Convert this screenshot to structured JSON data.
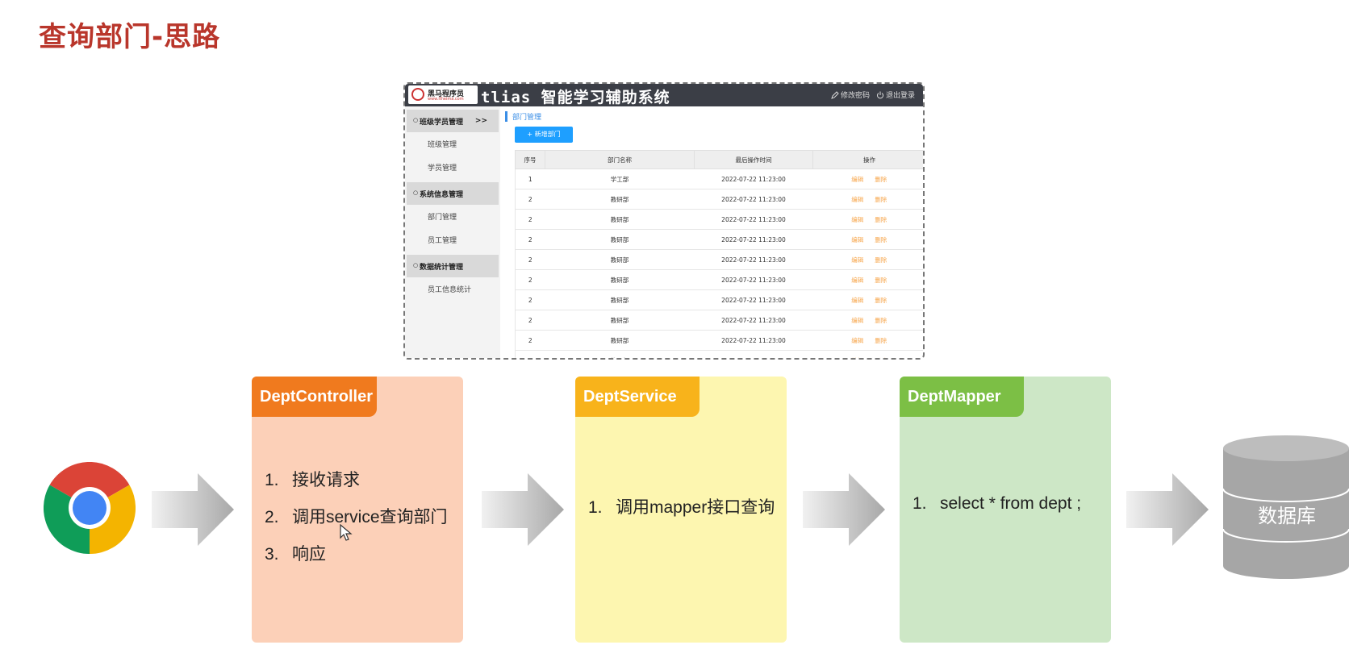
{
  "slide_title": "查询部门-思路",
  "screenshot": {
    "logo_text": "黑马程序员",
    "logo_sub": "www.itheima.com",
    "app_title": "tlias 智能学习辅助系统",
    "header_actions": [
      "修改密码",
      "退出登录"
    ],
    "sidebar": [
      {
        "type": "group",
        "label": "班级学员管理",
        "arrow": ">>"
      },
      {
        "type": "item",
        "label": "班级管理"
      },
      {
        "type": "item",
        "label": "学员管理"
      },
      {
        "type": "group",
        "label": "系统信息管理"
      },
      {
        "type": "item",
        "label": "部门管理"
      },
      {
        "type": "item",
        "label": "员工管理"
      },
      {
        "type": "group",
        "label": "数据统计管理"
      },
      {
        "type": "item",
        "label": "员工信息统计"
      }
    ],
    "breadcrumb": "部门管理",
    "add_button": "+ 新增部门",
    "table": {
      "columns": [
        "序号",
        "部门名称",
        "最后操作时间",
        "操作"
      ],
      "rows": [
        [
          "1",
          "学工部",
          "2022-07-22 11:23:00"
        ],
        [
          "2",
          "教研部",
          "2022-07-22 11:23:00"
        ],
        [
          "2",
          "教研部",
          "2022-07-22 11:23:00"
        ],
        [
          "2",
          "教研部",
          "2022-07-22 11:23:00"
        ],
        [
          "2",
          "教研部",
          "2022-07-22 11:23:00"
        ],
        [
          "2",
          "教研部",
          "2022-07-22 11:23:00"
        ],
        [
          "2",
          "教研部",
          "2022-07-22 11:23:00"
        ],
        [
          "2",
          "教研部",
          "2022-07-22 11:23:00"
        ],
        [
          "2",
          "教研部",
          "2022-07-22 11:23:00"
        ],
        [
          "2",
          "教研部",
          "2022-07-22 11:23:00"
        ]
      ],
      "actions": [
        "编辑",
        "删除"
      ]
    }
  },
  "flow": {
    "controller": {
      "title": "DeptController",
      "steps": [
        "1.",
        "接收请求",
        "2.",
        "调用service查询部门",
        "3.",
        "响应"
      ]
    },
    "service": {
      "title": "DeptService",
      "steps": [
        "1.",
        "调用mapper接口查询"
      ]
    },
    "mapper": {
      "title": "DeptMapper",
      "steps": [
        "1.",
        "select * from dept ;"
      ]
    },
    "database_label": "数据库"
  },
  "colors": {
    "title": "#b9362b",
    "controller_tab": "#f07a1e",
    "controller_body": "#fcd0b8",
    "service_tab": "#f8b31b",
    "service_body": "#fdf6b0",
    "mapper_tab": "#7cbf45",
    "mapper_body": "#cde7c6",
    "database": "#a6a6a6"
  },
  "icons": [
    "chrome-icon",
    "arrow-right-icon",
    "database-icon",
    "pencil-icon",
    "power-icon",
    "mouse-cursor-icon"
  ]
}
